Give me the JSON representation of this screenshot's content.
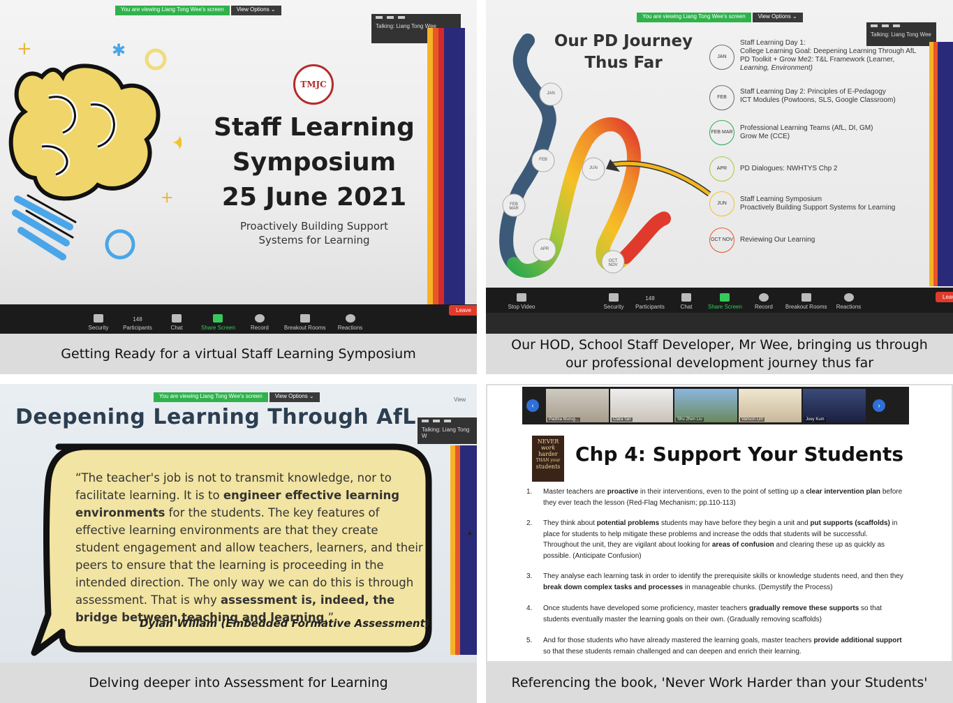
{
  "panel1": {
    "banner_viewing": "You are viewing Liang Tong Wee's screen",
    "banner_options": "View Options ⌄",
    "talking": "Talking: Liang Tong Wee",
    "logo_text": "TMJC",
    "title_line1": "Staff Learning",
    "title_line2": "Symposium",
    "title_line3": "25 June 2021",
    "subtitle_line1": "Proactively Building Support",
    "subtitle_line2": "Systems for Learning",
    "toolbar": {
      "security": "Security",
      "participants": "Participants",
      "participants_count": "148",
      "chat": "Chat",
      "share": "Share Screen",
      "record": "Record",
      "breakout": "Breakout Rooms",
      "reactions": "Reactions",
      "leave": "Leave"
    },
    "caption": "Getting Ready for a virtual Staff Learning Symposium"
  },
  "panel2": {
    "banner_viewing": "You are viewing Liang Tong Wee's screen",
    "banner_options": "View Options ⌄",
    "talking": "Talking: Liang Tong Wee",
    "title_line1": "Our PD Journey",
    "title_line2": "Thus Far",
    "path_labels": {
      "jan": "JAN",
      "feb": "FEB",
      "febmar": "FEB MAR",
      "apr": "APR",
      "jun": "JUN",
      "octnov": "OCT NOV"
    },
    "items": [
      {
        "badge": "JAN",
        "line1": "Staff Learning Day 1:",
        "line2": "College Learning Goal: Deepening Learning Through AfL",
        "line3": "PD Toolkit + Grow Me2: T&L Framework (Learner,",
        "line4": "Learning, Environment)"
      },
      {
        "badge": "FEB",
        "line1": "Staff Learning Day 2: Principles of E-Pedagogy",
        "line2": "ICT Modules (Powtoons, SLS, Google Classroom)",
        "line3": "",
        "line4": ""
      },
      {
        "badge": "FEB MAR",
        "line1": "Professional Learning Teams (AfL, DI, GM)",
        "line2": "Grow Me (CCE)",
        "line3": "",
        "line4": ""
      },
      {
        "badge": "APR",
        "line1": "PD Dialogues: NWHTYS Chp 2",
        "line2": "",
        "line3": "",
        "line4": ""
      },
      {
        "badge": "JUN",
        "line1": "Staff Learning Symposium",
        "line2": "Proactively Building Support Systems for Learning",
        "line3": "",
        "line4": ""
      },
      {
        "badge": "OCT NOV",
        "line1": "Reviewing Our Learning",
        "line2": "",
        "line3": "",
        "line4": ""
      }
    ],
    "toolbar": {
      "stop_video": "Stop Video",
      "security": "Security",
      "participants": "Participants",
      "participants_count": "148",
      "chat": "Chat",
      "share": "Share Screen",
      "record": "Record",
      "breakout": "Breakout Rooms",
      "reactions": "Reactions",
      "leave": "Leave"
    },
    "caption_line1": "Our HOD, School Staff Developer, Mr Wee, bringing us through",
    "caption_line2": "our professional development journey thus far"
  },
  "panel3": {
    "banner_viewing": "You are viewing Liang Tong Wee's screen",
    "banner_options": "View Options ⌄",
    "view_label": "View",
    "talking": "Talking: Liang Tong W",
    "heading": "Deepening Learning Through AfL",
    "quote_part1": "“The teacher's job is not to transmit knowledge, nor to facilitate learning. It is to ",
    "quote_bold1": "engineer effective learning environments",
    "quote_part2": " for the students. The key features of effective learning environments are that they create student engagement and allow teachers, learners, and their peers to ensure that the learning is proceeding in the intended direction. The only way we can do this is through assessment. That is why ",
    "quote_bold2": "assessment is, indeed, the bridge between teaching and learning",
    "quote_end": ".”",
    "attribution": "Dylan Wiliam (Embedded Formative Assessment)",
    "caption": "Delving deeper into Assessment for Learning"
  },
  "panel4": {
    "participants": [
      {
        "name": "Padma Murug..."
      },
      {
        "name": "Clara Tan"
      },
      {
        "name": "Shu Zhen Liu"
      },
      {
        "name": "Vanson Lim"
      },
      {
        "name": "Joey Kum"
      }
    ],
    "book_line1": "NEVER",
    "book_line2": "work",
    "book_line3": "harder",
    "book_line4": "THAN your",
    "book_line5": "students",
    "title": "Chp 4: Support Your Students",
    "points": [
      {
        "num": "1.",
        "segments": [
          {
            "t": "Master teachers are ",
            "b": false
          },
          {
            "t": "proactive",
            "b": true
          },
          {
            "t": " in their interventions, even to the point of setting up a ",
            "b": false
          },
          {
            "t": "clear intervention plan",
            "b": true
          },
          {
            "t": " before they ever teach the lesson (Red-Flag Mechanism; pp.110-113)",
            "b": false
          }
        ]
      },
      {
        "num": "2.",
        "segments": [
          {
            "t": "They think about ",
            "b": false
          },
          {
            "t": "potential problems",
            "b": true
          },
          {
            "t": " students may have before they begin a unit and ",
            "b": false
          },
          {
            "t": "put supports (scaffolds)",
            "b": true
          },
          {
            "t": " in place for students to help mitigate these problems and increase the odds that students will be successful. Throughout the unit, they are vigilant about looking for ",
            "b": false
          },
          {
            "t": "areas of confusion",
            "b": true
          },
          {
            "t": " and clearing these up as quickly as possible. (Anticipate Confusion)",
            "b": false
          }
        ]
      },
      {
        "num": "3.",
        "segments": [
          {
            "t": "They analyse each learning task in order to identify the prerequisite skills or knowledge students need, and then they ",
            "b": false
          },
          {
            "t": "break down complex tasks and processes",
            "b": true
          },
          {
            "t": " in manageable chunks. (Demystify the Process)",
            "b": false
          }
        ]
      },
      {
        "num": "4.",
        "segments": [
          {
            "t": "Once students have developed some proficiency, master teachers ",
            "b": false
          },
          {
            "t": "gradually remove these supports",
            "b": true
          },
          {
            "t": " so that students eventually master the learning goals on their own. (Gradually removing scaffolds)",
            "b": false
          }
        ]
      },
      {
        "num": "5.",
        "segments": [
          {
            "t": "And for those students who have already mastered the learning goals, master teachers ",
            "b": false
          },
          {
            "t": "provide additional support",
            "b": true
          },
          {
            "t": " so that these students remain challenged and can deepen and enrich their learning.",
            "b": false
          }
        ]
      }
    ],
    "caption": "Referencing the book, 'Never Work Harder than your Students'"
  },
  "colors": {
    "caption_bg": "#dcdcdc",
    "zoom_green": "#2fb24c",
    "leave_red": "#e03a2c",
    "quote_bg": "#f3e6a6",
    "accent_blue": "#2e6fd8"
  }
}
